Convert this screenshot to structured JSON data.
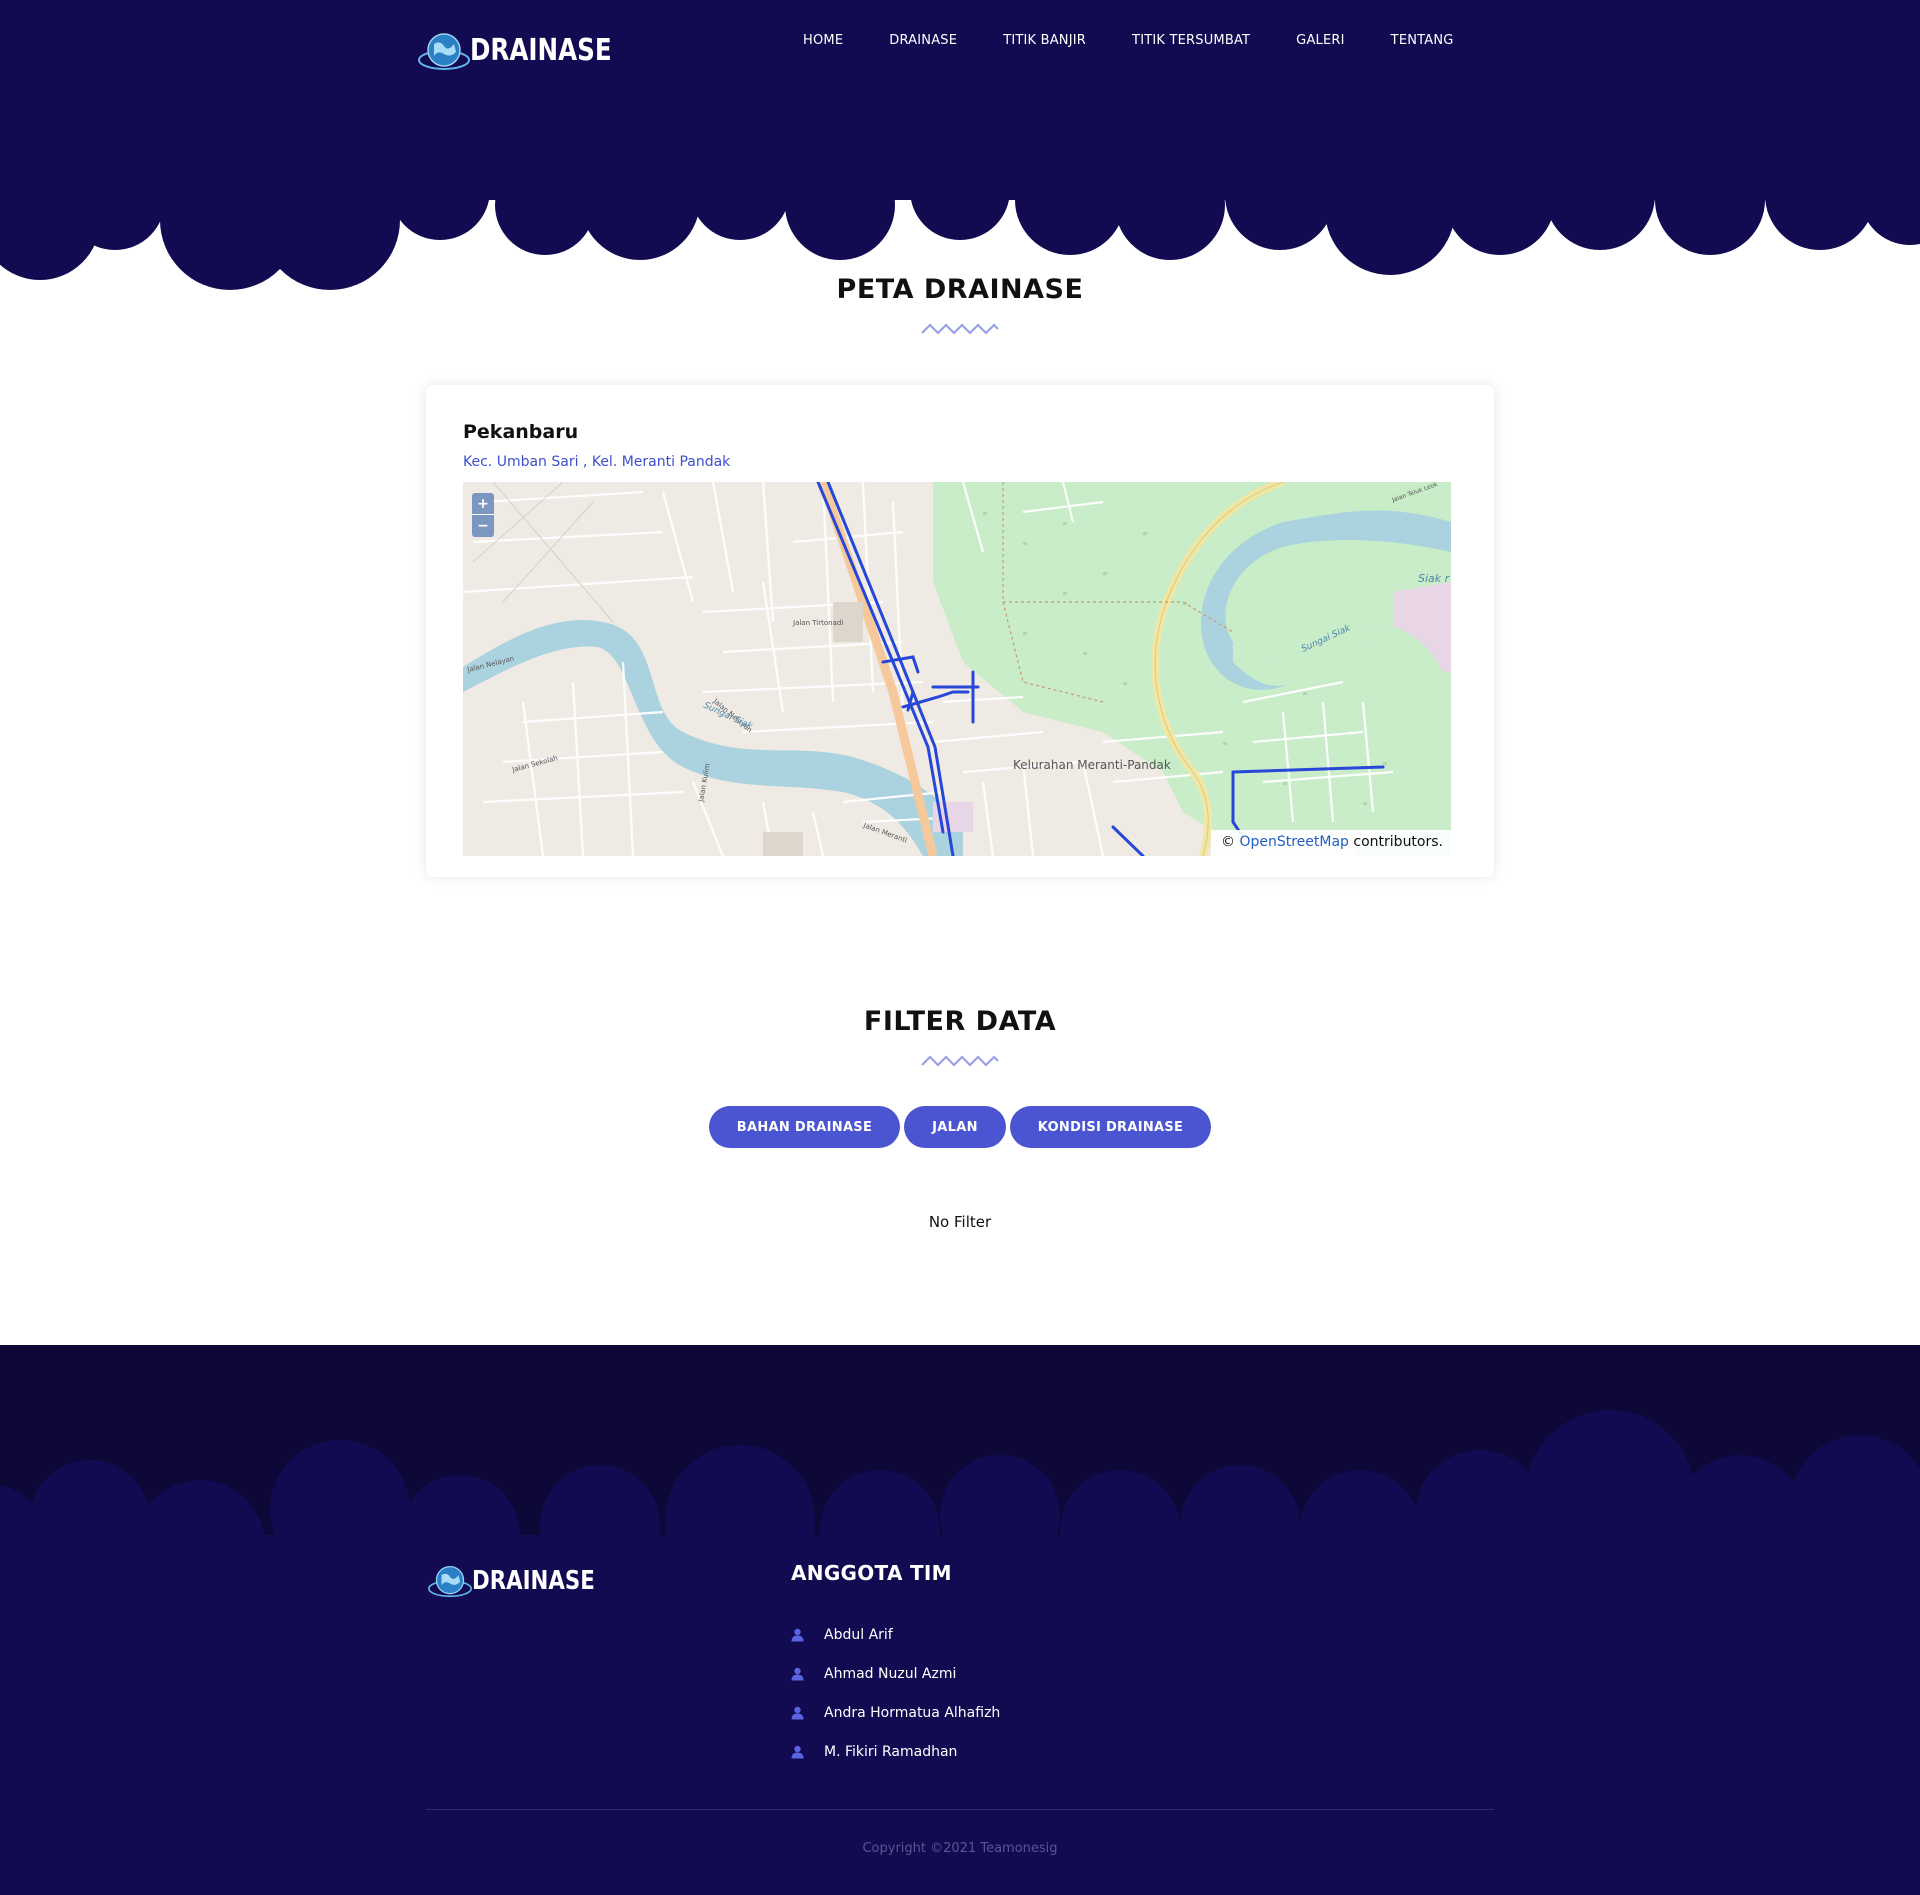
{
  "header": {
    "logo_text": "DRAINASE",
    "nav": [
      "HOME",
      "DRAINASE",
      "TITIK BANJIR",
      "TITIK TERSUMBAT",
      "GALERI",
      "TENTANG"
    ]
  },
  "map_section": {
    "title": "PETA DRAINASE",
    "card_title": "Pekanbaru",
    "card_subtitle": "Kec. Umban Sari , Kel. Meranti Pandak",
    "zoom_in": "+",
    "zoom_out": "−",
    "attribution_prefix": "©",
    "attribution_link": "OpenStreetMap",
    "attribution_suffix": "contributors.",
    "map_labels": {
      "area": "Kelurahan Meranti-Pandak",
      "river_west": "Sungai Siak",
      "river_east": "Sungai Siak",
      "river_ne": "Siak r",
      "street_1": "Jalan Tirtonadi",
      "street_2": "Jalan Nelayan",
      "street_3": "Jalan Nelayan",
      "street_4": "Jalan Sekolah",
      "street_5": "Jalan Kulim",
      "street_6": "Jalan Meranti",
      "street_7": "Jalan Teluk Leok"
    }
  },
  "filter_section": {
    "title": "FILTER DATA",
    "buttons": [
      "BAHAN DRAINASE",
      "JALAN",
      "KONDISI DRAINASE"
    ],
    "status": "No Filter"
  },
  "footer": {
    "logo_text": "DRAINASE",
    "team_title": "ANGGOTA TIM",
    "members": [
      "Abdul Arif",
      "Ahmad Nuzul Azmi",
      "Andra Hormatua Alhafizh",
      "M. Fikiri Ramadhan"
    ],
    "copyright": "Copyright ©2021 Teamonesig"
  },
  "colors": {
    "navy": "#130b52",
    "accent": "#4b55d1",
    "drain_line": "#2747d8"
  }
}
